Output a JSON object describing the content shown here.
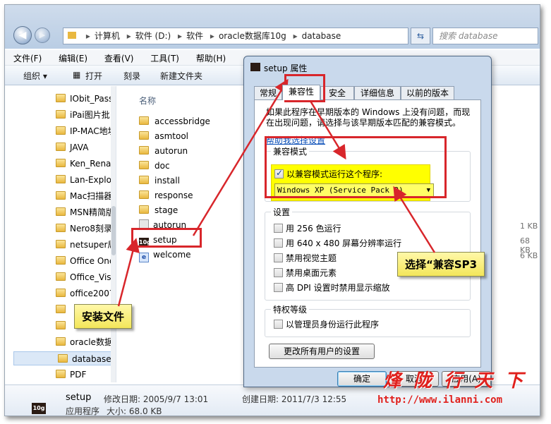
{
  "explorer": {
    "address_path": [
      "计算机",
      "软件 (D:)",
      "软件",
      "oracle数据库10g",
      "database"
    ],
    "search_placeholder": "搜索 database",
    "menu": [
      "文件(F)",
      "编辑(E)",
      "查看(V)",
      "工具(T)",
      "帮助(H)"
    ],
    "toolbar": {
      "organize": "组织 ▾",
      "open": "打开",
      "burn": "刻录",
      "new_folder": "新建文件夹"
    },
    "nav_items": [
      "IObit_Pass",
      "iPai图片批",
      "IP-MAC地址",
      "JAVA",
      "Ken_Renar",
      "Lan-Explo",
      "Mac扫描器",
      "MSN精简版",
      "Nero8刻录",
      "netsuper局",
      "Office One",
      "Office_Visi",
      "office2007",
      "",
      "",
      "oracle数据",
      "database",
      "PDF"
    ],
    "column_name": "名称",
    "files": [
      {
        "name": "accessbridge",
        "type": "folder",
        "size": ""
      },
      {
        "name": "asmtool",
        "type": "folder",
        "size": ""
      },
      {
        "name": "autorun",
        "type": "folder",
        "size": ""
      },
      {
        "name": "doc",
        "type": "folder",
        "size": ""
      },
      {
        "name": "install",
        "type": "folder",
        "size": ""
      },
      {
        "name": "response",
        "type": "folder",
        "size": ""
      },
      {
        "name": "stage",
        "type": "folder",
        "size": ""
      },
      {
        "name": "autorun",
        "type": "config",
        "size": "1 KB"
      },
      {
        "name": "setup",
        "type": "app",
        "size": "68 KB"
      },
      {
        "name": "welcome",
        "type": "html",
        "size": "6 KB"
      }
    ],
    "details": {
      "name": "setup",
      "modified_label": "修改日期: 2005/9/7 13:01",
      "type_label": "应用程序",
      "size_label": "大小: 68.0 KB",
      "created_label": "创建日期: 2011/7/3 12:55"
    }
  },
  "dialog": {
    "title": "setup 属性",
    "tabs": [
      "常规",
      "兼容性",
      "安全",
      "详细信息",
      "以前的版本"
    ],
    "active_tab": "兼容性",
    "intro": "如果此程序在早期版本的 Windows 上没有问题，而现在出现问题，请选择与该早期版本匹配的兼容模式。",
    "help_link": "帮助我选择设置",
    "compat_group": "兼容模式",
    "compat_checkbox": "以兼容模式运行这个程序:",
    "compat_checked": true,
    "os_selected": "Windows XP (Service Pack 3)",
    "settings_group": "设置",
    "settings": [
      "用 256 色运行",
      "用 640 x 480 屏幕分辨率运行",
      "禁用视觉主题",
      "禁用桌面元素",
      "高 DPI 设置时禁用显示缩放"
    ],
    "privilege_group": "特权等级",
    "privilege_checkbox": "以管理员身份运行此程序",
    "all_users_button": "更改所有用户的设置",
    "ok": "确定",
    "cancel": "取消",
    "apply": "应用(A)"
  },
  "annotations": {
    "install_file": "安装文件",
    "choose_sp3": "选择“兼容SP3",
    "watermark": "烽 陇 行 天 下",
    "watermark_url": "http://www.ilanni.com"
  },
  "colors": {
    "annotation_red": "#d8262b",
    "highlight_yellow": "#ffff00",
    "callout_yellow": "#fff8a8"
  }
}
